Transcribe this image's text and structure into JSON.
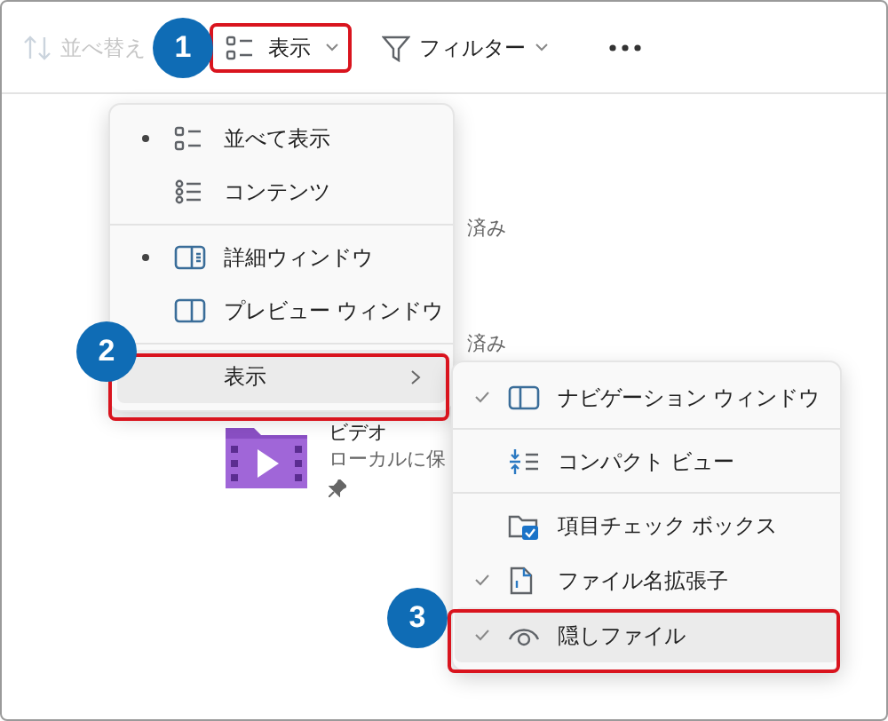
{
  "toolbar": {
    "buttons": [
      {
        "kind": "sort",
        "label": "並べ替え",
        "disabled": true,
        "caret": false
      },
      {
        "kind": "view",
        "label": "表示",
        "disabled": false,
        "caret": true
      },
      {
        "kind": "filter",
        "label": "フィルター",
        "disabled": false,
        "caret": true
      },
      {
        "kind": "more",
        "disabled": false,
        "caret": false
      }
    ]
  },
  "content": {
    "status_texts": [
      "済み",
      "済み"
    ],
    "item": {
      "name": "ビデオ",
      "detail": "ローカルに保",
      "pinned": true
    }
  },
  "view_menu": {
    "items": [
      {
        "kind": "tiles",
        "label": "並べて表示",
        "selected": true,
        "hovered": false,
        "submenu": false
      },
      {
        "kind": "content",
        "label": "コンテンツ",
        "selected": false,
        "hovered": false,
        "submenu": false
      },
      {
        "kind": "details",
        "label": "詳細ウィンドウ",
        "selected": true,
        "hovered": false,
        "submenu": false
      },
      {
        "kind": "preview",
        "label": "プレビュー ウィンドウ",
        "selected": false,
        "hovered": false,
        "submenu": false
      },
      {
        "kind": "none",
        "label": "表示",
        "selected": false,
        "hovered": true,
        "submenu": true
      }
    ]
  },
  "show_submenu": {
    "items": [
      {
        "kind": "nav",
        "label": "ナビゲーション ウィンドウ",
        "checked": true,
        "hovered": false
      },
      {
        "kind": "compact",
        "label": "コンパクト ビュー",
        "checked": false,
        "hovered": false
      },
      {
        "kind": "checkbox",
        "label": "項目チェック ボックス",
        "checked": false,
        "hovered": false
      },
      {
        "kind": "extension",
        "label": "ファイル名拡張子",
        "checked": true,
        "hovered": false
      },
      {
        "kind": "eye",
        "label": "隠しファイル",
        "checked": true,
        "hovered": true
      }
    ]
  },
  "annotations": [
    {
      "number": "1"
    },
    {
      "number": "2"
    },
    {
      "number": "3"
    }
  ]
}
